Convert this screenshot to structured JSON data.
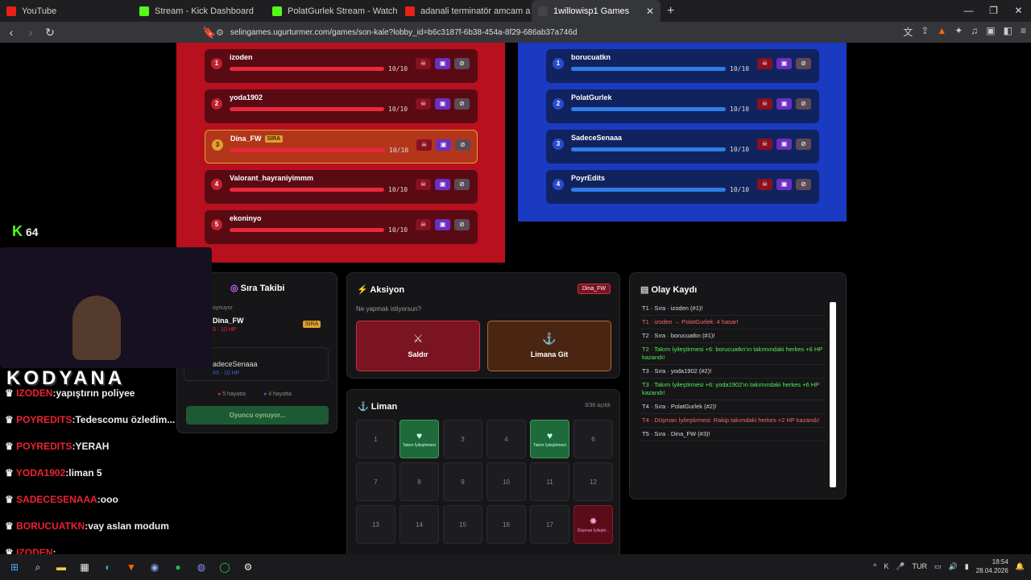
{
  "tabs": [
    {
      "label": "YouTube",
      "color": "#e62117"
    },
    {
      "label": "Stream - Kick Dashboard",
      "color": "#53fc18"
    },
    {
      "label": "PolatGurlek Stream - Watch Live on K",
      "color": "#53fc18"
    },
    {
      "label": "adanali terminatör amcam a donduı",
      "color": "#e62117"
    },
    {
      "label": "1willowisp1 Games",
      "color": "#222"
    }
  ],
  "url": "selingames.ugurturmer.com/games/son-kale?lobby_id=b6c3187f-6b38-454a-8f29-686ab37a746d",
  "red_team": [
    {
      "rank": "1",
      "name": "izoden",
      "hp": "10/10",
      "hp_fraction": 1.0
    },
    {
      "rank": "2",
      "name": "yoda1902",
      "hp": "10/10",
      "hp_fraction": 1.0
    },
    {
      "rank": "3",
      "name": "Dina_FW",
      "hp": "10/10",
      "hp_fraction": 1.0,
      "badge": "SIRA"
    },
    {
      "rank": "4",
      "name": "Valorant_hayraniyimmm",
      "hp": "10/10",
      "hp_fraction": 1.0
    },
    {
      "rank": "5",
      "name": "ekoninyo",
      "hp": "10/10",
      "hp_fraction": 1.0
    }
  ],
  "blue_team": [
    {
      "rank": "1",
      "name": "borucuatkn",
      "hp": "10/10",
      "hp_fraction": 1.0
    },
    {
      "rank": "2",
      "name": "PolatGurlek",
      "hp": "10/10",
      "hp_fraction": 1.0
    },
    {
      "rank": "3",
      "name": "SadeceSenaaa",
      "hp": "10/10",
      "hp_fraction": 1.0
    },
    {
      "rank": "4",
      "name": "PoyrEdits",
      "hp": "10/10",
      "hp_fraction": 1.0
    }
  ],
  "sira_takibi": {
    "title": "Sıra Takibi",
    "label_now": "oynuyor",
    "current": "Dina_FW",
    "current_hp": "3 · 10 HP",
    "current_badge": "SIRA",
    "next": "adeceSenaaa",
    "next_hp": "#3 · 10 HP",
    "red_alive": "5 hayatta",
    "blue_alive": "4 hayatta",
    "status_btn": "Oyuncu oynuyor..."
  },
  "aksiyon": {
    "title": "Aksiyon",
    "player": "Dina_FW",
    "prompt": "Ne yapmak istiyorsun?",
    "attack_label": "Saldır",
    "port_label": "Limana Git"
  },
  "liman": {
    "title": "Liman",
    "count": "3/36 açıldı",
    "cells": [
      {
        "n": "1"
      },
      {
        "n": "",
        "type": "heal",
        "text": "Takım İyileştirmesi"
      },
      {
        "n": "3"
      },
      {
        "n": "4"
      },
      {
        "n": "",
        "type": "heal",
        "text": "Takım İyileştirmesi"
      },
      {
        "n": "6"
      },
      {
        "n": "7"
      },
      {
        "n": "8"
      },
      {
        "n": "9"
      },
      {
        "n": "10"
      },
      {
        "n": "11"
      },
      {
        "n": "12"
      },
      {
        "n": "13"
      },
      {
        "n": "14"
      },
      {
        "n": "15"
      },
      {
        "n": "16"
      },
      {
        "n": "17"
      },
      {
        "n": "",
        "type": "dmg",
        "text": "Düşman İyileştir..."
      }
    ]
  },
  "olay": {
    "title": "Olay Kaydı",
    "entries": [
      {
        "text": "T1 · Sıra · izoden (#1)!",
        "color": "#ddd"
      },
      {
        "text": "T1 · izoden → PolatGurlek: 4 hasar!",
        "color": "#f66"
      },
      {
        "text": "T2 · Sıra · borucuatkn (#1)!",
        "color": "#ddd"
      },
      {
        "text": "T2 · Takım İyileştirmesi +6: borucuatkn'ın takımındaki herkes +6 HP kazandı!",
        "color": "#5e5"
      },
      {
        "text": "T3 · Sıra · yoda1902 (#2)!",
        "color": "#ddd"
      },
      {
        "text": "T3 · Takım İyileştirmesi +6: yoda1902'ın takımındaki herkes +6 HP kazandı!",
        "color": "#5e5"
      },
      {
        "text": "T4 · Sıra · PolatGurlek (#2)!",
        "color": "#ddd"
      },
      {
        "text": "T4 · Düşman İyileştirmesi: Rakip takımdaki herkes +2 HP kazandı!",
        "color": "#f66"
      },
      {
        "text": "T5 · Sıra · Dina_FW (#3)!",
        "color": "#ddd"
      }
    ]
  },
  "stream_overlay": {
    "kick_count": "64",
    "streamer_name": "KODYANA",
    "chat": [
      {
        "user": "IZODEN",
        "msg": "yapıştırın poliyee",
        "color": "#e23"
      },
      {
        "user": "POYREDITS",
        "msg": "Tedescomu özledim...",
        "color": "#e23"
      },
      {
        "user": "POYREDITS",
        "msg": "YERAH",
        "color": "#e23"
      },
      {
        "user": "YODA1902",
        "msg": "liman 5",
        "color": "#e23"
      },
      {
        "user": "SADECESENAAA",
        "msg": "ooo",
        "color": "#e23"
      },
      {
        "user": "BORUCUATKN",
        "msg": "vay aslan modum",
        "color": "#e23"
      },
      {
        "user": "IZODEN",
        "msg": "",
        "color": "#e23"
      }
    ]
  },
  "taskbar": {
    "lang": "TUR",
    "time": "18:54",
    "date": "28.04.2026"
  }
}
